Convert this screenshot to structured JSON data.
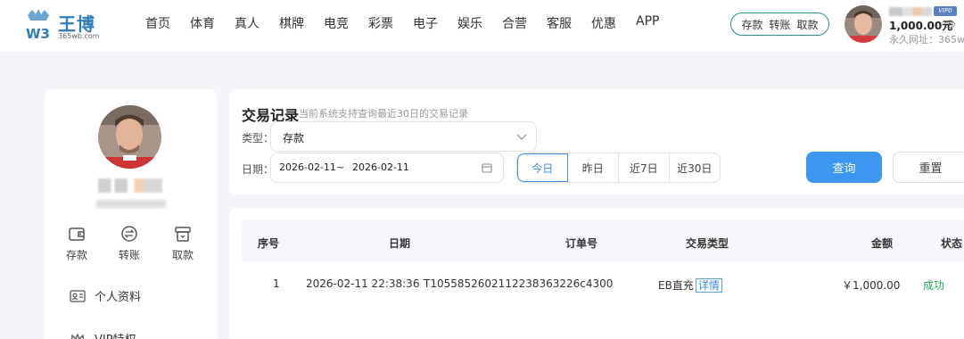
{
  "header": {
    "brand": "王博",
    "domain": "365wb.com",
    "nav": [
      "首页",
      "体育",
      "真人",
      "棋牌",
      "电竞",
      "彩票",
      "电子",
      "娱乐",
      "合营",
      "客服",
      "优惠",
      "APP"
    ],
    "wallet_actions": [
      "存款",
      "转账",
      "取款"
    ],
    "vip_badge": "VIP0",
    "balance": "1,000.00元",
    "permanent_url": "永久网址：365w"
  },
  "sidebar": {
    "quick_actions": [
      {
        "label": "存款",
        "icon": "wallet-icon"
      },
      {
        "label": "转账",
        "icon": "transfer-icon"
      },
      {
        "label": "取款",
        "icon": "withdraw-icon"
      }
    ],
    "menu": [
      {
        "label": "个人资料",
        "icon": "id-card-icon"
      },
      {
        "label": "VIP特权",
        "icon": "crown-icon"
      }
    ]
  },
  "filter": {
    "title": "交易记录",
    "subtitle": "当前系统支持查询最近30日的交易记录",
    "type_label": "类型：",
    "type_value": "存款",
    "date_label": "日期：",
    "date_start": "2026-02-11",
    "date_sep": "~",
    "date_end": "2026-02-11",
    "ranges": [
      "今日",
      "昨日",
      "近7日",
      "近30日"
    ],
    "active_range": "今日",
    "query_label": "查询",
    "reset_label": "重置"
  },
  "table": {
    "columns": [
      "序号",
      "日期",
      "订单号",
      "交易类型",
      "金额",
      "状态"
    ],
    "rows": [
      {
        "index": "1",
        "date": "2026-02-11 22:38:36",
        "order_no": "T1055852602112238363226c4300",
        "type": "EB直充",
        "detail_label": "详情",
        "amount": "￥1,000.00",
        "status": "成功"
      }
    ]
  },
  "colors": {
    "primary": "#3d96f0",
    "brand": "#2e7cb8",
    "success": "#2aa35a",
    "page_bg": "#f3f5f9"
  }
}
